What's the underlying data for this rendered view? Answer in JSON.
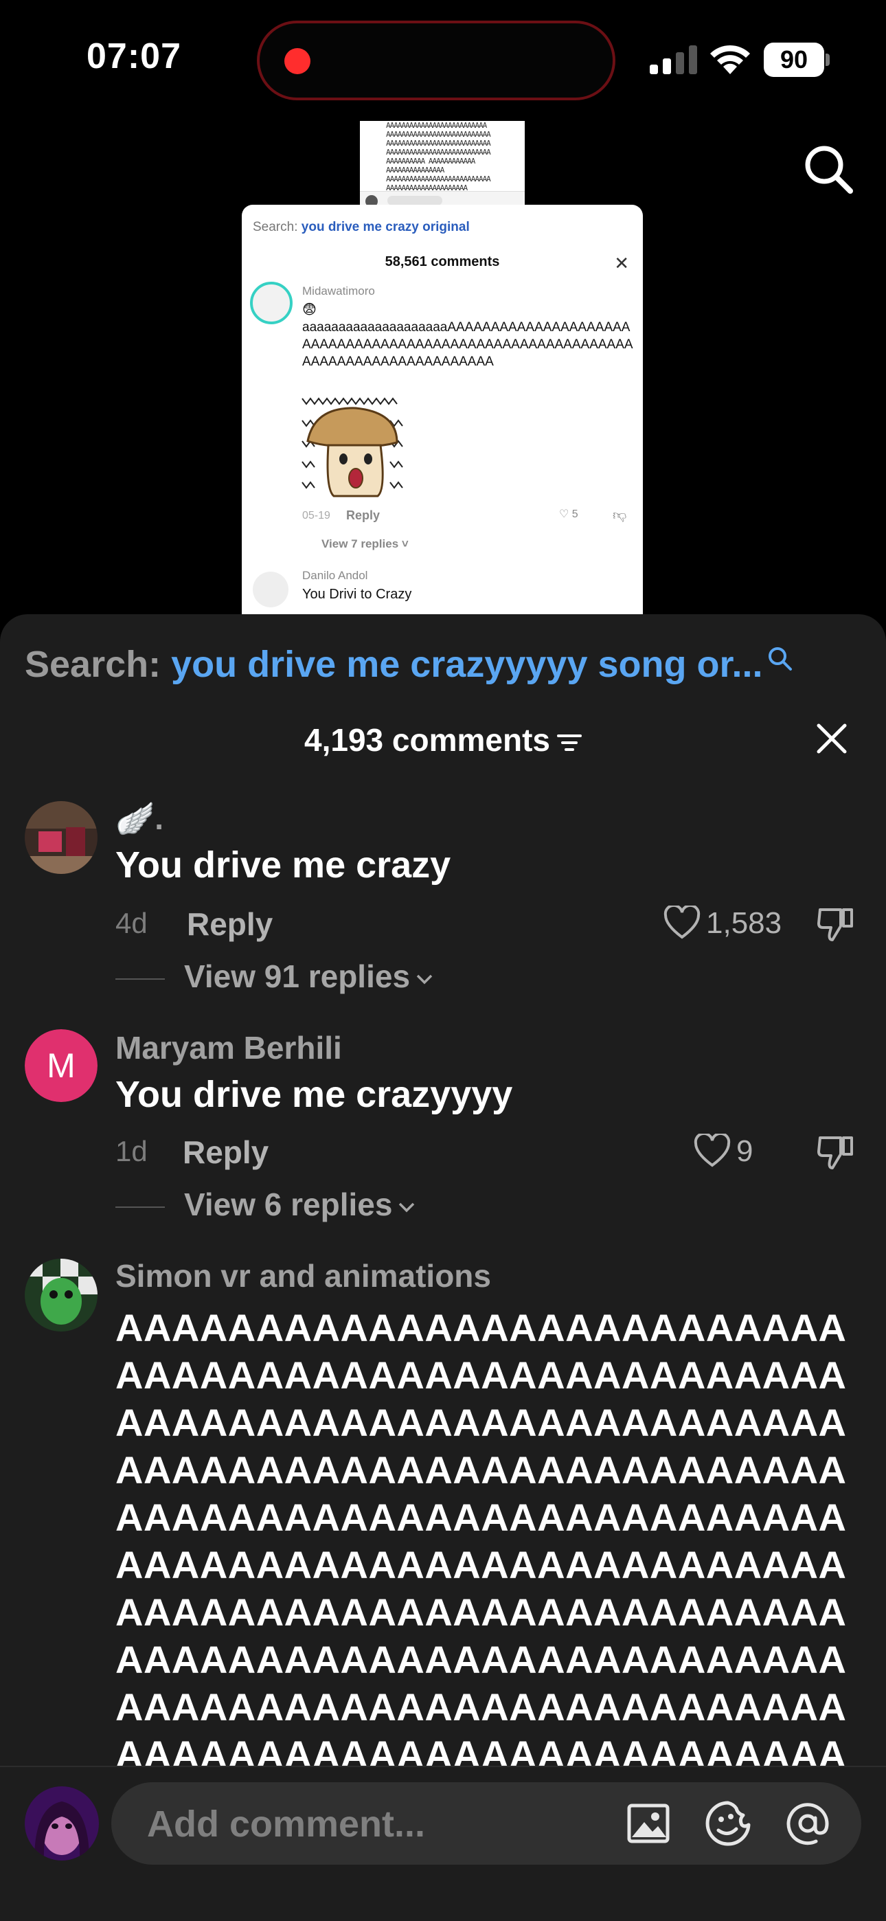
{
  "status": {
    "time": "07:07",
    "battery": "90"
  },
  "video": {
    "back_lines": "AAAAAAAAAAAAAAAAAAAAAAAAAA\nAAAAAAAAAAAAAAAAAAAAAAAAAAA\nAAAAAAAAAAAAAAAAAAAAAAAAAAA\nAAAAAAAAAAAAAAAAAAAAAAAAAAA\nAAAAAAAAAA AAAAAAAAAAAA\nAAAAAAAAAAAAAAA\nAAAAAAAAAAAAAAAAAAAAAAAAAAA\nAAAAAAAAAAAAAAAAAAAAA",
    "search_label": "Search:",
    "search_query": "you drive me crazy original",
    "comment_count": "58,561 comments",
    "comment_user": "Midawatimoro",
    "comment_emoji": "😨",
    "comment_text": "aaaaaaaaaaaaaaaaaaaaAAAAAAAAAAAAAAAAAAAAAAAAAAAAAAAAAAAAAAAAAAAAAAAAAAAAAAAAAAAAAAAAAAAAAAAAAAAAAAAAA",
    "comment_date": "05-19",
    "comment_reply": "Reply",
    "comment_likes": "5",
    "view_replies": "View 7 replies",
    "second_user": "Danilo Andol",
    "second_text": "You Drivi to Crazy"
  },
  "sheet": {
    "search_label": "Search:",
    "search_query": "you drive me crazyyyyy song or...",
    "comment_count": "4,193 comments",
    "comments": [
      {
        "name": "🪽.",
        "text": "You drive me crazy",
        "age": "4d",
        "reply": "Reply",
        "likes": "1,583",
        "view_replies": "View 91 replies"
      },
      {
        "name": "Maryam Berhili",
        "avatar_letter": "M",
        "avatar_color": "#e0306e",
        "text": "You drive me crazyyyy",
        "age": "1d",
        "reply": "Reply",
        "likes": "9",
        "view_replies": "View 6 replies"
      },
      {
        "name": "Simon vr and animations",
        "text": "AAAAAAAAAAAAAAAAAAAAAAAAAAAAAAAAAAAAAAAAAAAAAAAAAAAAAAAAAAAAAAAAAAAAAAAAAAAAAAAAAAAAAAAAAAAAAAAAAAAAAAAAAAAAAAAAAAAAAAAAAAAAAAAAAAAAAAAAAAAAAAAAAAAAAAAAAAAAAAAAAAAAAAAAAAAAAAAAAAAAAAAAAAAAAAAAAAAAAAAAAAAAAAAAAAAAAAAAAAAAAAAAAAAAAAAAAAAAAAAAAAAAAAAAAAAAAAAAAAAAAAAAAAAAA"
      }
    ]
  },
  "composer": {
    "placeholder": "Add comment..."
  },
  "icons": {
    "status": [
      "record-icon",
      "cellular-signal-icon",
      "wifi-icon",
      "battery-icon"
    ],
    "top": [
      "search-icon"
    ],
    "sheet": [
      "search-icon",
      "filter-icon",
      "close-icon",
      "heart-icon",
      "dislike-icon",
      "chevron-down-icon"
    ],
    "composer": [
      "image-icon",
      "emoji-icon",
      "mention-icon"
    ]
  },
  "colors": {
    "sheet_bg": "#1d1d1d",
    "link_blue": "#5aa6f2",
    "record_red": "#ff2d2d",
    "avatar_pink": "#e0306e"
  }
}
